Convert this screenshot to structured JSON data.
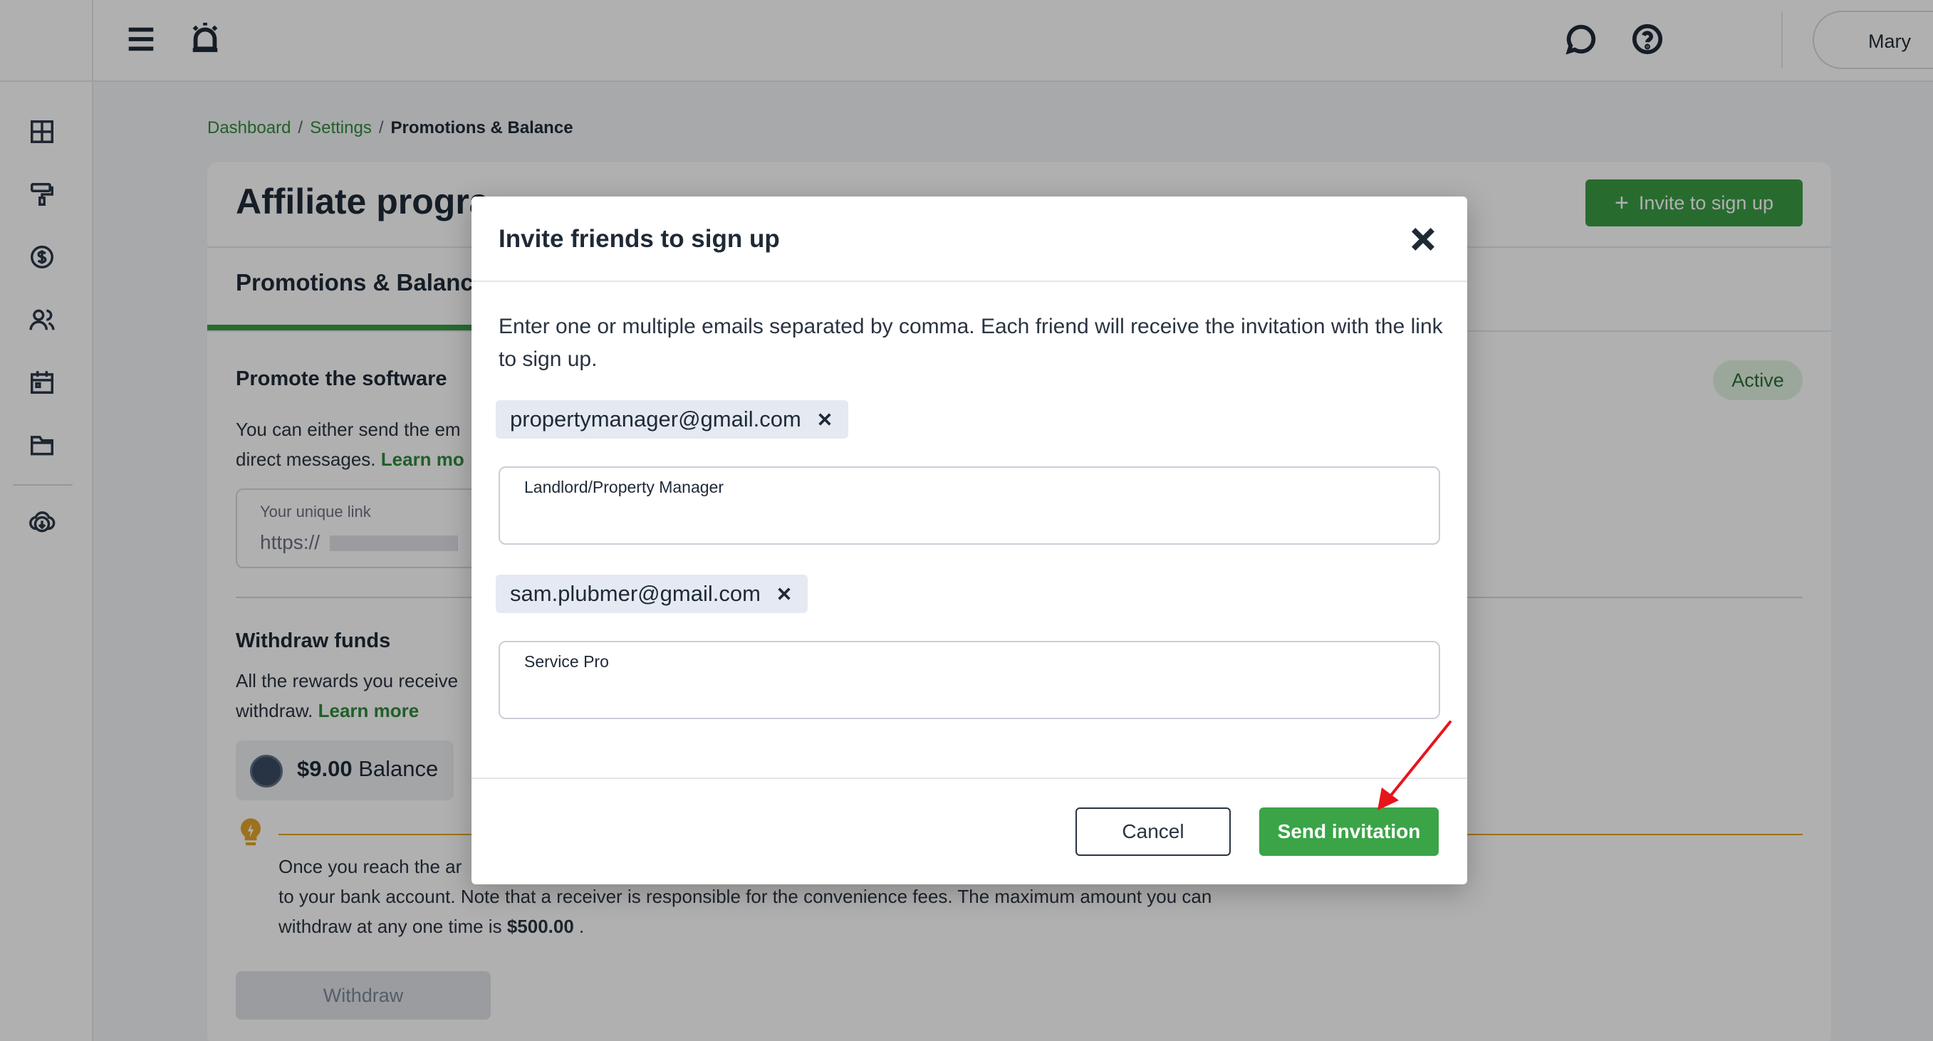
{
  "topbar": {
    "user_name": "Mary",
    "icons": [
      "menu-icon",
      "alarm-icon",
      "chat-icon",
      "help-icon"
    ]
  },
  "sidebar": {
    "icons": [
      "dashboard-icon",
      "paint-roller-icon",
      "dollar-icon",
      "users-icon",
      "calendar-icon",
      "folder-icon",
      "cloud-download-icon"
    ]
  },
  "breadcrumb": {
    "items": [
      "Dashboard",
      "Settings"
    ],
    "current": "Promotions & Balance",
    "separator": "/"
  },
  "page": {
    "title": "Affiliate progra",
    "invite_button": "Invite to sign up",
    "tab": "Promotions & Balanc",
    "promote": {
      "title": "Promote the software",
      "text_line1": "You can either send the em",
      "text_line2": "direct messages.",
      "learn_more": "Learn mo",
      "status": "Active"
    },
    "unique_link": {
      "label": "Your unique link",
      "value": "https://"
    },
    "withdraw": {
      "title": "Withdraw funds",
      "text_line1": "All the rewards you receive",
      "text_line2": "withdraw.",
      "learn_more": "Learn more",
      "balance_amount": "$9.00",
      "balance_label": "Balance",
      "info_line1": "Once you reach the ar",
      "info_line2": "to your bank account. Note that a receiver is responsible for the convenience fees. The maximum amount you can",
      "info_line3": "withdraw at any one time is",
      "max_amount": "$500.00",
      "info_end": ".",
      "button": "Withdraw"
    }
  },
  "modal": {
    "title": "Invite friends to sign up",
    "description": "Enter one or multiple emails separated by comma. Each friend will receive the invitation with the link to sign up.",
    "invitees": [
      {
        "email": "propertymanager@gmail.com",
        "role": "Landlord/Property Manager"
      },
      {
        "email": "sam.plubmer@gmail.com",
        "role": "Service Pro"
      }
    ],
    "cancel_label": "Cancel",
    "send_label": "Send invitation"
  },
  "colors": {
    "brand_green": "#3aa447",
    "link_green": "#2f8a3c",
    "annotation_arrow": "#e8141c"
  }
}
